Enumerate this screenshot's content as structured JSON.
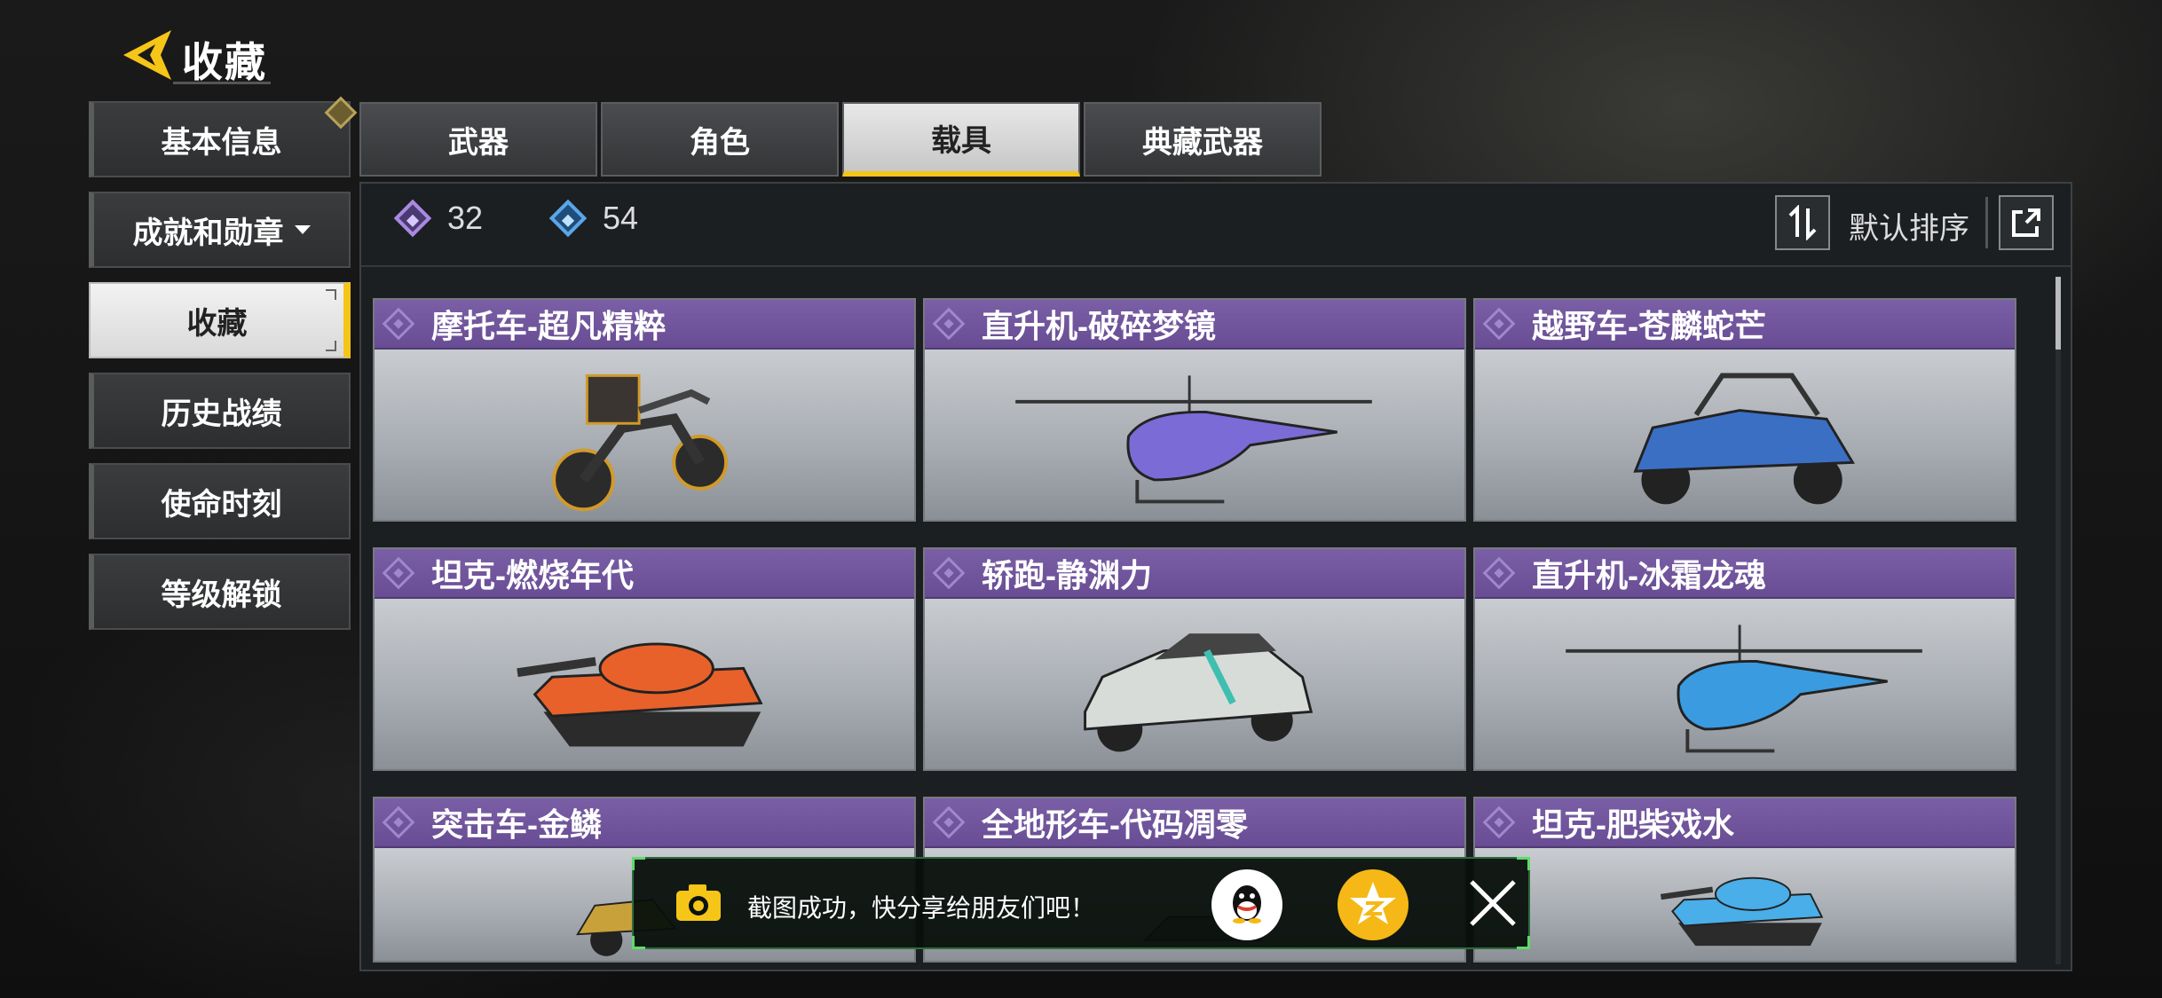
{
  "header": {
    "title": "收藏",
    "back_icon": "back-arrow-icon"
  },
  "sidebar": {
    "items": [
      {
        "label": "基本信息",
        "badge": true
      },
      {
        "label": "成就和勋章",
        "dropdown": true
      },
      {
        "label": "收藏",
        "active": true
      },
      {
        "label": "历史战绩"
      },
      {
        "label": "使命时刻"
      },
      {
        "label": "等级解锁"
      }
    ]
  },
  "tabs": [
    {
      "label": "武器"
    },
    {
      "label": "角色"
    },
    {
      "label": "载具",
      "active": true
    },
    {
      "label": "典藏武器"
    }
  ],
  "stats": {
    "purple_count": "32",
    "blue_count": "54"
  },
  "toolbar": {
    "sort_label": "默认排序",
    "sort_icon": "sort-arrows-icon",
    "share_icon": "share-icon"
  },
  "cards": [
    {
      "name": "摩托车-超凡精粹",
      "vehicle": "motorcycle",
      "accent": "#d19a2a"
    },
    {
      "name": "直升机-破碎梦镜",
      "vehicle": "helicopter",
      "accent": "#7a6bd6"
    },
    {
      "name": "越野车-苍麟蛇芒",
      "vehicle": "buggy",
      "accent": "#3b6fc4"
    },
    {
      "name": "坦克-燃烧年代",
      "vehicle": "tank",
      "accent": "#e8612a"
    },
    {
      "name": "轿跑-静渊力",
      "vehicle": "sports-car",
      "accent": "#3fbfb0"
    },
    {
      "name": "直升机-冰霜龙魂",
      "vehicle": "helicopter",
      "accent": "#3a9be0"
    },
    {
      "name": "突击车-金鳞",
      "vehicle": "assault-vehicle",
      "accent": "#c9a13a"
    },
    {
      "name": "全地形车-代码凋零",
      "vehicle": "atv",
      "accent": "#6b6b6b"
    },
    {
      "name": "坦克-肥柴戏水",
      "vehicle": "tank",
      "accent": "#4aaee8"
    }
  ],
  "toast": {
    "message": "截图成功，快分享给朋友们吧！",
    "camera_icon": "camera-icon",
    "qq_icon": "qq-icon",
    "qzone_icon": "qzone-icon",
    "close_icon": "close-icon"
  }
}
